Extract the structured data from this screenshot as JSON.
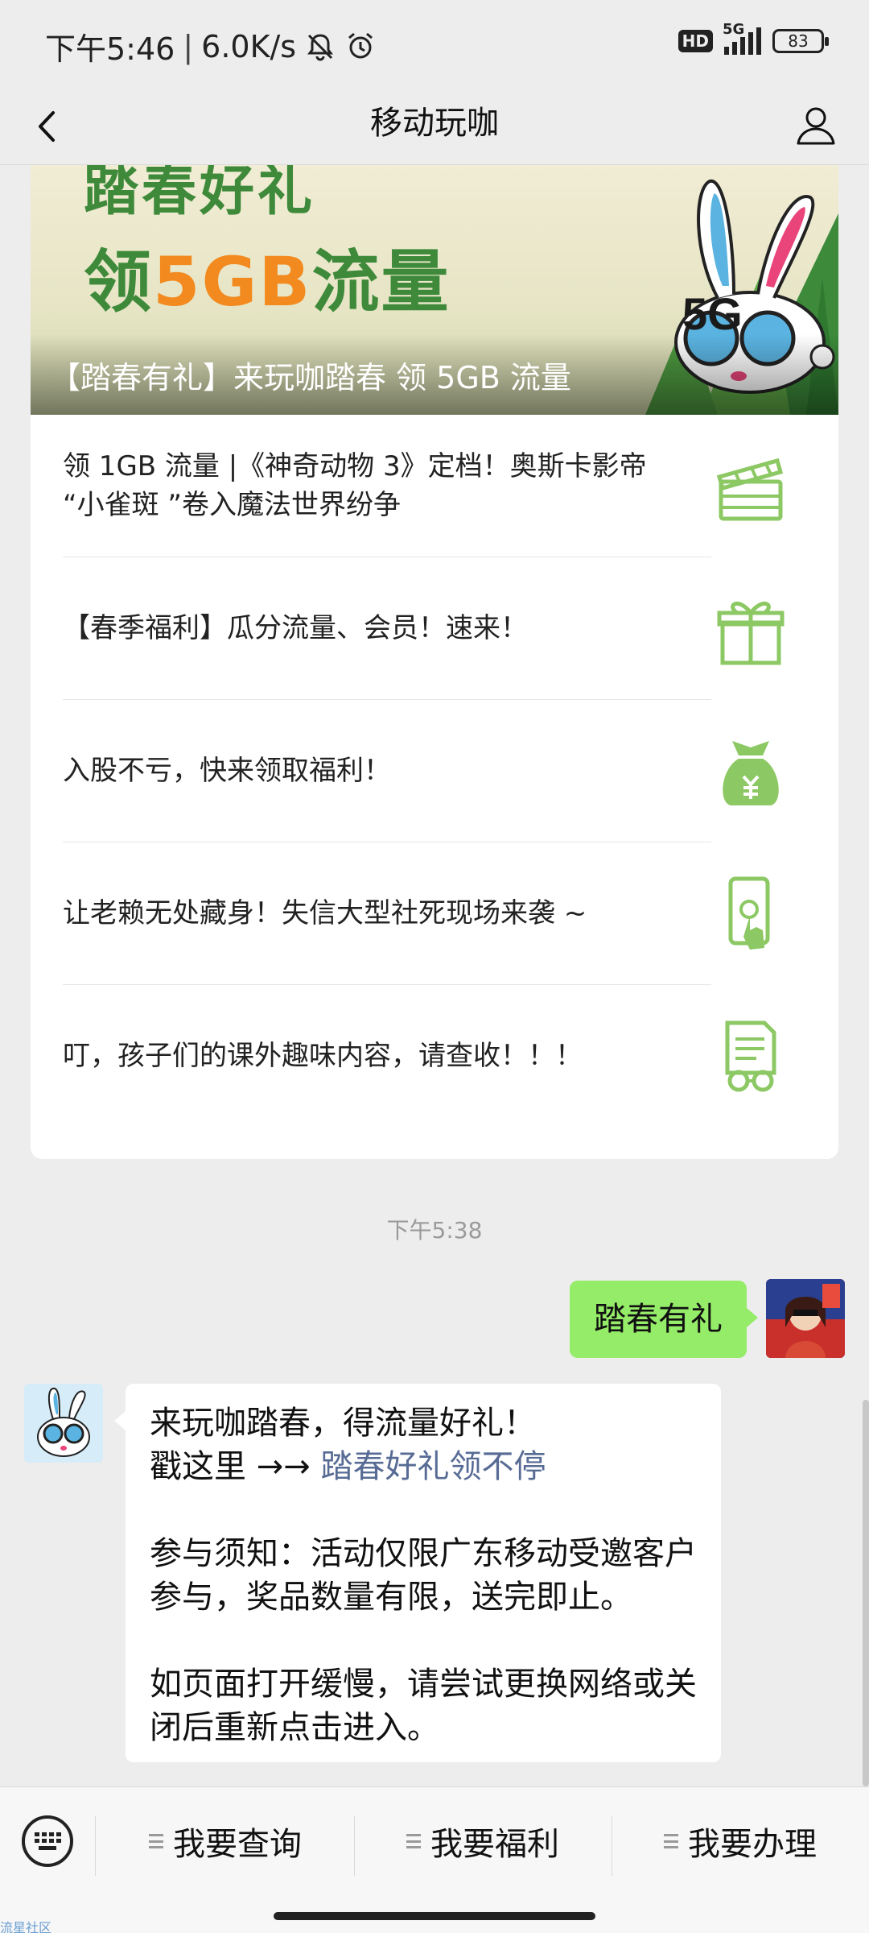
{
  "status_bar": {
    "time": "下午5:46",
    "speed": "6.0K/s",
    "hd": "HD",
    "network": "5G",
    "battery": "83",
    "icons": [
      "mute-bell-icon",
      "alarm-icon",
      "signal-icon",
      "battery-icon"
    ]
  },
  "nav": {
    "title": "移动玩咖",
    "back_icon": "chevron-left-icon",
    "profile_icon": "person-icon"
  },
  "banner": {
    "line1": "踏春好礼",
    "line2_prefix": "领",
    "line2_highlight": "5GB",
    "line2_suffix": "流量",
    "caption": "【踏春有礼】来玩咖踏春 领 5GB 流量",
    "art_text": "5G"
  },
  "articles": [
    {
      "text": "领 1GB 流量 |《神奇动物 3》定档！奥斯卡影帝 “小雀斑 ”卷入魔法世界纷争",
      "icon": "clapperboard-icon"
    },
    {
      "text": "【春季福利】瓜分流量、会员！速来！",
      "icon": "gift-icon"
    },
    {
      "text": "入股不亏，快来领取福利！",
      "icon": "money-bag-icon"
    },
    {
      "text": "让老赖无处藏身！失信大型社死现场来袭 ~",
      "icon": "phone-touch-icon"
    },
    {
      "text": "叮，孩子们的课外趣味内容，请查收！！！",
      "icon": "reading-document-icon"
    }
  ],
  "chat": {
    "timestamp": "下午5:38",
    "sent_message": "踏春有礼",
    "received": {
      "line1": "来玩咖踏春，得流量好礼！",
      "line2_prefix": "戳这里 →→ ",
      "line2_link": "踏春好礼领不停",
      "para2": "参与须知：活动仅限广东移动受邀客户参与，奖品数量有限，送完即止。",
      "para3": "如页面打开缓慢，请尝试更换网络或关闭后重新点击进入。"
    }
  },
  "bottom_menu": {
    "keyboard_icon": "keyboard-icon",
    "items": [
      "我要查询",
      "我要福利",
      "我要办理"
    ]
  },
  "watermark": "流星社区",
  "colors": {
    "sent_bubble": "#95ec69",
    "link": "#576b95",
    "icon_green": "#8cc863",
    "banner_green": "#3e8a3a",
    "banner_orange": "#f28a1f"
  }
}
